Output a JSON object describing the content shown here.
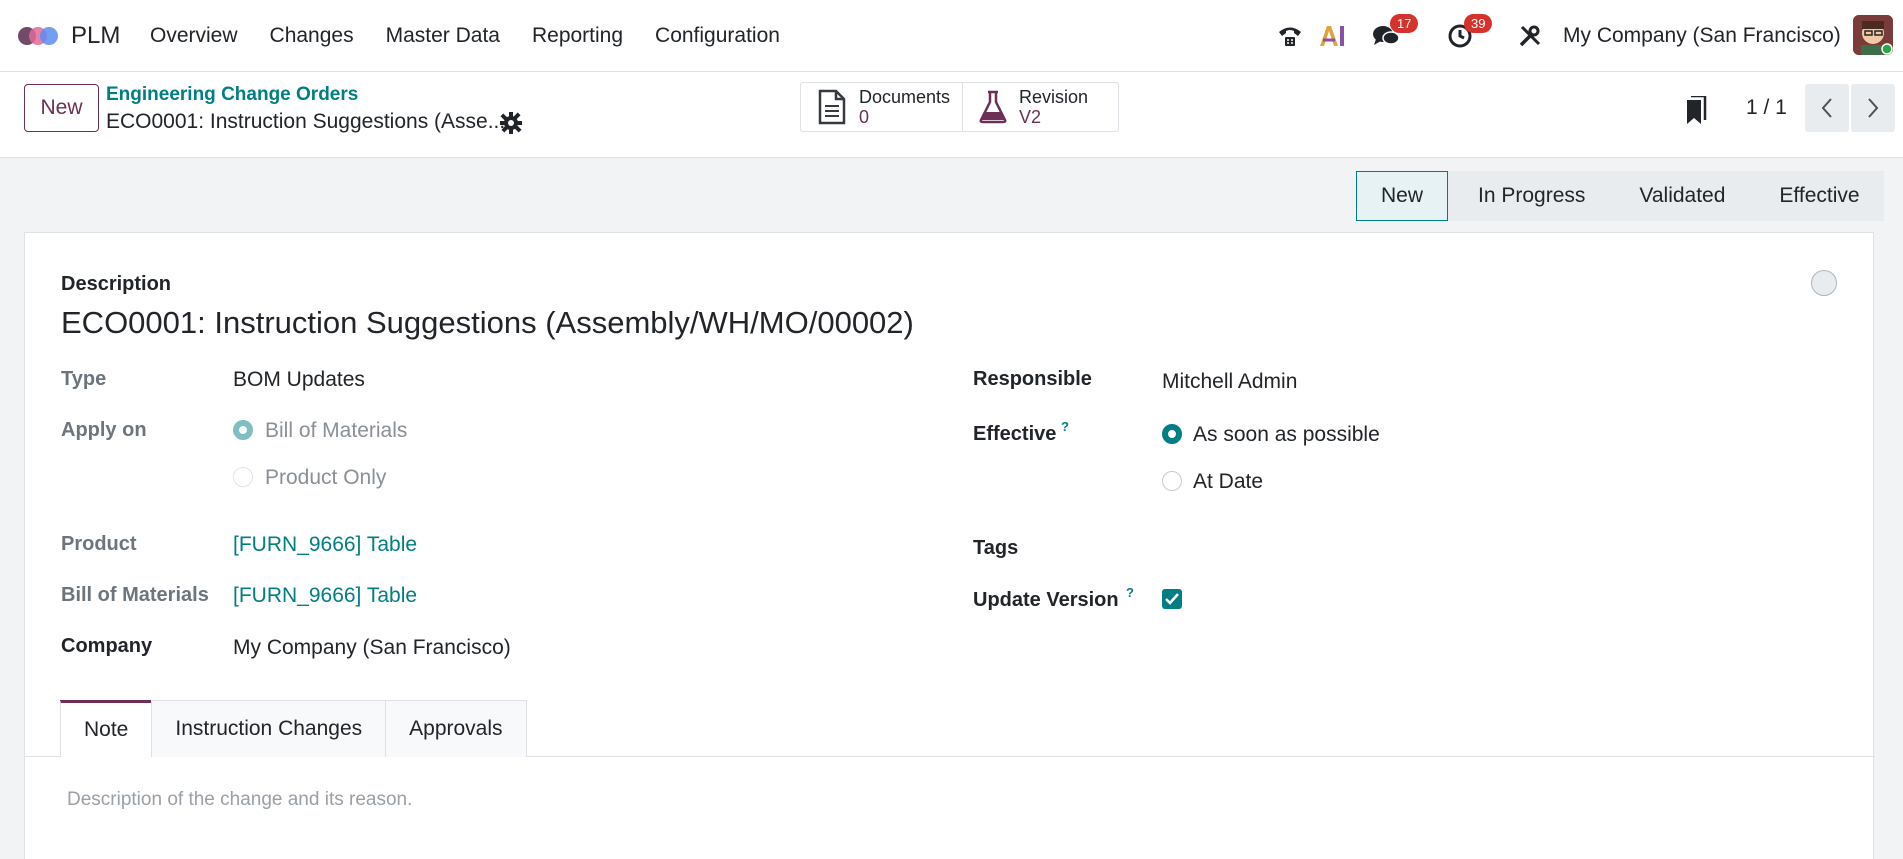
{
  "app": {
    "name": "PLM",
    "menu": [
      "Overview",
      "Changes",
      "Master Data",
      "Reporting",
      "Configuration"
    ],
    "company": "My Company (San Francisco)",
    "badges": {
      "messages": "17",
      "activities": "39"
    },
    "accent": "#017e84",
    "brand": "#6c2f55"
  },
  "control": {
    "new_label": "New",
    "breadcrumb": "Engineering Change Orders",
    "record_title": "ECO0001: Instruction Suggestions (Asse...",
    "smart_buttons": [
      {
        "label": "Documents",
        "value": "0",
        "icon": "document-icon"
      },
      {
        "label": "Revision",
        "value": "V2",
        "icon": "flask-icon"
      }
    ],
    "pager": "1 / 1"
  },
  "stages": [
    "New",
    "In Progress",
    "Validated",
    "Effective"
  ],
  "form": {
    "description_label": "Description",
    "description": "ECO0001: Instruction Suggestions (Assembly/WH/MO/00002)",
    "type_label": "Type",
    "type": "BOM Updates",
    "apply_on_label": "Apply on",
    "apply_on_options": [
      "Bill of Materials",
      "Product Only"
    ],
    "product_label": "Product",
    "product": "[FURN_9666] Table",
    "bom_label": "Bill of Materials",
    "bom": "[FURN_9666] Table",
    "company_label": "Company",
    "company": "My Company (San Francisco)",
    "responsible_label": "Responsible",
    "responsible": "Mitchell Admin",
    "effective_label": "Effective",
    "effective_options": [
      "As soon as possible",
      "At Date"
    ],
    "tags_label": "Tags",
    "update_version_label": "Update Version",
    "help_mark": "?"
  },
  "tabs": [
    "Note",
    "Instruction Changes",
    "Approvals"
  ],
  "note_placeholder": "Description of the change and its reason."
}
